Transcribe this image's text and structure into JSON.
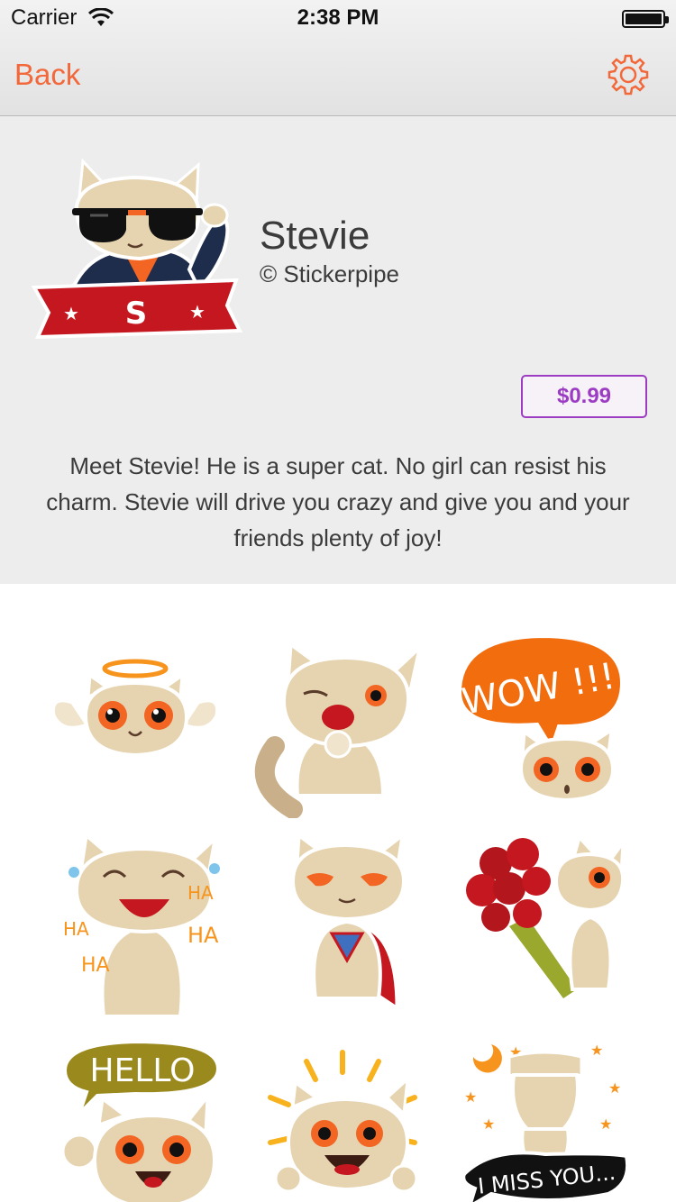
{
  "status_bar": {
    "carrier": "Carrier",
    "time": "2:38 PM"
  },
  "nav": {
    "back_label": "Back",
    "settings_icon": "gear-icon"
  },
  "pack": {
    "name": "Stevie",
    "artist": "© Stickerpipe",
    "price": "$0.99",
    "description": "Meet Stevie! He is a super cat. No girl can resist his charm. Stevie will drive you crazy and give you and your friends plenty of joy!",
    "banner_letter": "S"
  },
  "stickers": [
    {
      "name": "angel-cat"
    },
    {
      "name": "giggle-cat"
    },
    {
      "name": "wow-cat",
      "text": "WOW !!!"
    },
    {
      "name": "laughing-cat",
      "text": "HA"
    },
    {
      "name": "super-cat"
    },
    {
      "name": "flowers-cat"
    },
    {
      "name": "hello-cat",
      "text": "HELLO"
    },
    {
      "name": "excited-cat"
    },
    {
      "name": "miss-you-cat",
      "text": "I MISS YOU..."
    }
  ],
  "colors": {
    "accent": "#f2683a",
    "price": "#9b3cc2",
    "panel": "#ededed",
    "cat": "#e6d3b0",
    "eye": "#f26522"
  }
}
